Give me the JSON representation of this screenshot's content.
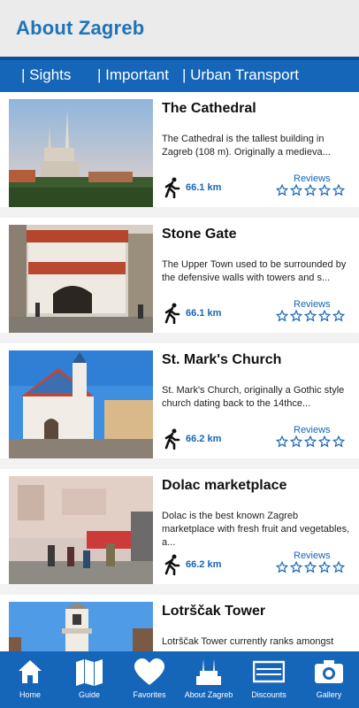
{
  "header": {
    "title": "About Zagreb"
  },
  "tabs": [
    {
      "label": "| Sights"
    },
    {
      "label": "| Important"
    },
    {
      "label": "| Urban Transport"
    }
  ],
  "reviews_label": "Reviews",
  "sights": [
    {
      "title": "The Cathedral",
      "description": "The Cathedral is the tallest building in Zagreb (108 m). Originally a medieva...",
      "distance": "66.1 km"
    },
    {
      "title": "Stone Gate",
      "description": "The Upper Town used to be surrounded by the defensive walls with towers and s...",
      "distance": "66.1 km"
    },
    {
      "title": "St. Mark's Church",
      "description": "St. Mark's Church, originally a Gothic style church dating back to the 14thce...",
      "distance": "66.2 km"
    },
    {
      "title": "Dolac marketplace",
      "description": "Dolac is the best known Zagreb marketplace with fresh fruit and vegetables, a...",
      "distance": "66.2 km"
    },
    {
      "title": "Lotrščak Tower",
      "description": "Lotrščak Tower currently ranks amongst",
      "distance": ""
    }
  ],
  "bottom_nav": [
    {
      "label": "Home",
      "icon": "home-icon"
    },
    {
      "label": "Guide",
      "icon": "map-icon"
    },
    {
      "label": "Favorites",
      "icon": "heart-icon"
    },
    {
      "label": "About Zagreb",
      "icon": "cathedral-icon"
    },
    {
      "label": "Discounts",
      "icon": "ticket-icon"
    },
    {
      "label": "Gallery",
      "icon": "camera-icon"
    }
  ],
  "colors": {
    "accent": "#1565b8",
    "title_text": "#1f74b8"
  }
}
